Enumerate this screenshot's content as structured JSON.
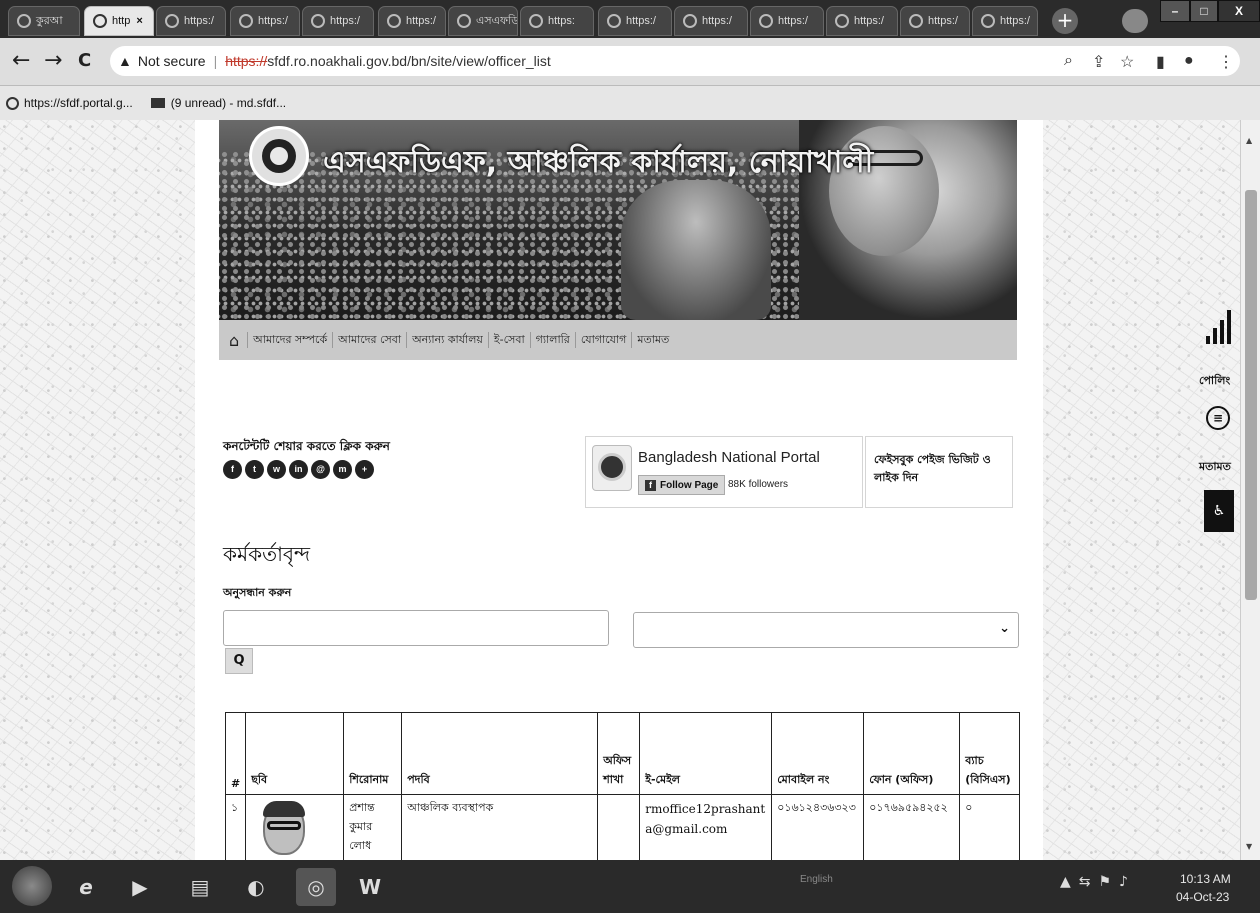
{
  "browser": {
    "tabs": [
      {
        "label": "কুরআ"
      },
      {
        "label": "http",
        "active": true
      },
      {
        "label": "https:/"
      },
      {
        "label": "https:/"
      },
      {
        "label": "https:/"
      },
      {
        "label": "https:/"
      },
      {
        "label": "এসএফডি"
      },
      {
        "label": "https:"
      },
      {
        "label": "https:/"
      },
      {
        "label": "https:/"
      },
      {
        "label": "https:/"
      },
      {
        "label": "https:/"
      },
      {
        "label": "https:/"
      },
      {
        "label": "https:/"
      }
    ],
    "tab_close_glyph": "×",
    "new_tab_glyph": "+",
    "window_controls": {
      "minimize": "–",
      "maximize": "□",
      "close": "X"
    },
    "nav": {
      "back": "←",
      "forward": "→",
      "reload": "C"
    },
    "address": {
      "warning_glyph": "▲",
      "security_label": "Not secure",
      "separator": "|",
      "scheme": "https://",
      "rest": "sfdf.ro.noakhali.gov.bd/bn/site/view/officer_list"
    },
    "bookmarks": [
      {
        "label": "https://sfdf.portal.g..."
      },
      {
        "label": "(9 unread) - md.sfdf..."
      }
    ]
  },
  "site": {
    "title": "এসএফডিএফ, আঞ্চলিক কার্যালয়, নোয়াখালী",
    "nav_items": [
      "আমাদের সম্পর্কে",
      "আমাদের সেবা",
      "অন্যান্য কার্যালয়",
      "ই-সেবা",
      "গ্যালারি",
      "যোগাযোগ",
      "মতামত"
    ],
    "home_glyph": "⌂",
    "share_label": "কনটেন্টটি শেয়ার করতে ক্লিক করুন",
    "share_icons": [
      {
        "name": "facebook-share-icon",
        "glyph": "f"
      },
      {
        "name": "twitter-share-icon",
        "glyph": "t"
      },
      {
        "name": "whatsapp-share-icon",
        "glyph": "w"
      },
      {
        "name": "linkedin-share-icon",
        "glyph": "in"
      },
      {
        "name": "email-share-icon",
        "glyph": "@"
      },
      {
        "name": "messenger-share-icon",
        "glyph": "m"
      },
      {
        "name": "more-share-icon",
        "glyph": "+"
      }
    ],
    "portal": {
      "name": "Bangladesh National Portal",
      "follow_label": "Follow Page",
      "followers": "88K followers"
    },
    "fb_visit_label": "ফেইসবুক পেইজ ভিজিট ও লাইক দিন",
    "page_title": "কর্মকর্তাবৃন্দ",
    "search_label": "অনুসন্ধান করুন",
    "search_button_glyph": "🔍",
    "select_chevron": "⌄"
  },
  "table": {
    "headers": [
      "#",
      "ছবি",
      "শিরোনাম",
      "পদবি",
      "অফিস শাখা",
      "ই-মেইল",
      "মোবাইল নং",
      "ফোন (অফিস)",
      "ব্যাচ (বিসিএস)"
    ],
    "rows": [
      {
        "index": "১",
        "name": "প্রশান্ত কুমার লোধ",
        "designation": "আঞ্চলিক ব্যবস্থাপক",
        "branch": "",
        "email": "rmoffice12prashanta@gmail.com",
        "mobile": "০১৬১২৪৩৬৩২৩",
        "phone": "০১৭৬৯৫৯৪২৫২",
        "batch": "০"
      }
    ]
  },
  "widgets": {
    "poll_label": "পোলিং",
    "feedback_label": "মতামত",
    "accessibility_glyph": "✝"
  },
  "taskbar": {
    "tray_text": "English",
    "time": "10:13 AM",
    "date": "04-Oct-23"
  }
}
